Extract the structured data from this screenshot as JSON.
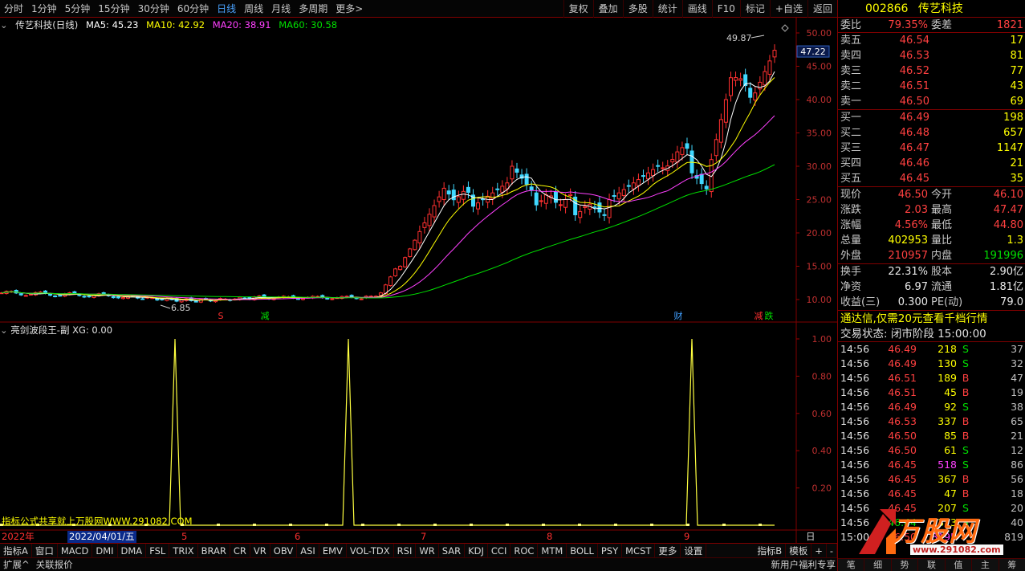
{
  "topbar": {
    "left_items": [
      "分时",
      "1分钟",
      "5分钟",
      "15分钟",
      "30分钟",
      "60分钟",
      "日线",
      "周线",
      "月线",
      "多周期",
      "更多>"
    ],
    "active": "日线",
    "right_items": [
      "复权",
      "叠加",
      "多股",
      "统计",
      "画线",
      "F10",
      "标记",
      "+自选",
      "返回"
    ]
  },
  "chart_info": {
    "name": "传艺科技(日线)",
    "ma5": "MA5: 45.23",
    "ma10": "MA10: 42.92",
    "ma20": "MA20: 38.91",
    "ma60": "MA60: 30.58",
    "colors": {
      "ma5": "#ffffff",
      "ma10": "#ffff00",
      "ma20": "#ff40ff",
      "ma60": "#00e000"
    }
  },
  "price_axis": [
    "50.00",
    "45.00",
    "40.00",
    "35.00",
    "30.00",
    "25.00",
    "20.00",
    "15.00",
    "10.00"
  ],
  "current_price_tag": "47.22",
  "high_label": "49.87",
  "low_label": "6.85",
  "markers": [
    {
      "text": "S",
      "color": "#ff3030"
    },
    {
      "text": "减",
      "color": "#00e000"
    },
    {
      "text": "财",
      "color": "#40a0ff"
    },
    {
      "text": "减",
      "color": "#ff3030"
    },
    {
      "text": "跌",
      "color": "#00e000"
    }
  ],
  "sub_info": "亮剑波段王-副 XG: 0.00",
  "sub_axis": [
    "1.00",
    "0.80",
    "0.60",
    "0.40",
    "0.20"
  ],
  "sub_footer": "指标公式共享就上万股网WWW.291082.COM",
  "date_axis": {
    "year": "2022年",
    "selected": "2022/04/01/五",
    "months": [
      "5",
      "6",
      "7",
      "8",
      "9"
    ],
    "period": "日线"
  },
  "stock": {
    "code": "002866",
    "name": "传艺科技"
  },
  "weibi": {
    "label1": "委比",
    "value1": "79.35%",
    "label2": "委差",
    "value2": "1821"
  },
  "asks": [
    {
      "label": "卖五",
      "price": "46.54",
      "vol": "17"
    },
    {
      "label": "卖四",
      "price": "46.53",
      "vol": "81"
    },
    {
      "label": "卖三",
      "price": "46.52",
      "vol": "77"
    },
    {
      "label": "卖二",
      "price": "46.51",
      "vol": "43"
    },
    {
      "label": "卖一",
      "price": "46.50",
      "vol": "69"
    }
  ],
  "bids": [
    {
      "label": "买一",
      "price": "46.49",
      "vol": "198"
    },
    {
      "label": "买二",
      "price": "46.48",
      "vol": "657"
    },
    {
      "label": "买三",
      "price": "46.47",
      "vol": "1147"
    },
    {
      "label": "买四",
      "price": "46.46",
      "vol": "21"
    },
    {
      "label": "买五",
      "price": "46.45",
      "vol": "35"
    }
  ],
  "quote": [
    {
      "l1": "现价",
      "v1": "46.50",
      "c1": "red",
      "l2": "今开",
      "v2": "46.10",
      "c2": "red"
    },
    {
      "l1": "涨跌",
      "v1": "2.03",
      "c1": "red",
      "l2": "最高",
      "v2": "47.47",
      "c2": "red"
    },
    {
      "l1": "涨幅",
      "v1": "4.56%",
      "c1": "red",
      "l2": "最低",
      "v2": "44.80",
      "c2": "red"
    },
    {
      "l1": "总量",
      "v1": "402953",
      "c1": "yellow",
      "l2": "量比",
      "v2": "1.3",
      "c2": "yellow"
    },
    {
      "l1": "外盘",
      "v1": "210957",
      "c1": "red",
      "l2": "内盘",
      "v2": "191996",
      "c2": "green"
    }
  ],
  "fundamentals": [
    {
      "l1": "换手",
      "v1": "22.31%",
      "l2": "股本",
      "v2": "2.90亿"
    },
    {
      "l1": "净资",
      "v1": "6.97",
      "l2": "流通",
      "v2": "1.81亿"
    },
    {
      "l1": "收益(三)",
      "v1": "0.300",
      "l2": "PE(动)",
      "v2": "79.0"
    }
  ],
  "banner": "通达信,仅需20元查看千档行情",
  "trade_status": "交易状态: 闭市阶段 15:00:00",
  "ticks": [
    {
      "t": "14:56",
      "p": "46.49",
      "v": "218",
      "d": "S",
      "n": "37"
    },
    {
      "t": "14:56",
      "p": "46.49",
      "v": "130",
      "d": "S",
      "n": "32"
    },
    {
      "t": "14:56",
      "p": "46.51",
      "v": "189",
      "d": "B",
      "n": "47"
    },
    {
      "t": "14:56",
      "p": "46.51",
      "v": "45",
      "d": "B",
      "n": "19"
    },
    {
      "t": "14:56",
      "p": "46.49",
      "v": "92",
      "d": "S",
      "n": "38"
    },
    {
      "t": "14:56",
      "p": "46.53",
      "v": "337",
      "d": "B",
      "n": "65"
    },
    {
      "t": "14:56",
      "p": "46.50",
      "v": "85",
      "d": "B",
      "n": "21"
    },
    {
      "t": "14:56",
      "p": "46.50",
      "v": "61",
      "d": "S",
      "n": "12"
    },
    {
      "t": "14:56",
      "p": "46.45",
      "v": "518",
      "d": "S",
      "n": "86"
    },
    {
      "t": "14:56",
      "p": "46.45",
      "v": "367",
      "d": "B",
      "n": "56"
    },
    {
      "t": "14:56",
      "p": "46.45",
      "v": "47",
      "d": "B",
      "n": "18"
    },
    {
      "t": "14:56",
      "p": "46.45",
      "v": "207",
      "d": "S",
      "n": "20"
    },
    {
      "t": "14:56",
      "p": "46.44",
      "v": "313",
      "d": "S",
      "n": "40"
    },
    {
      "t": "15:00",
      "p": "46.50",
      "v": "8195",
      "d": "",
      "n": "819"
    }
  ],
  "right_tabs": [
    "笔",
    "细",
    "势",
    "联",
    "值",
    "主",
    "筹"
  ],
  "indicator_tabs": [
    "指标A",
    "窗口",
    "MACD",
    "DMI",
    "DMA",
    "FSL",
    "TRIX",
    "BRAR",
    "CR",
    "VR",
    "OBV",
    "ASI",
    "EMV",
    "VOL-TDX",
    "RSI",
    "WR",
    "SAR",
    "KDJ",
    "CCI",
    "ROC",
    "MTM",
    "BOLL",
    "PSY",
    "MCST",
    "更多",
    "设置"
  ],
  "indicator_right": [
    "指标B",
    "模板",
    "+",
    "-"
  ],
  "bottom": {
    "expand": "扩展^",
    "link": "关联报价",
    "right": "新用户福利专享"
  },
  "watermark": {
    "text": "万股网",
    "url": "www.291082.com"
  }
}
